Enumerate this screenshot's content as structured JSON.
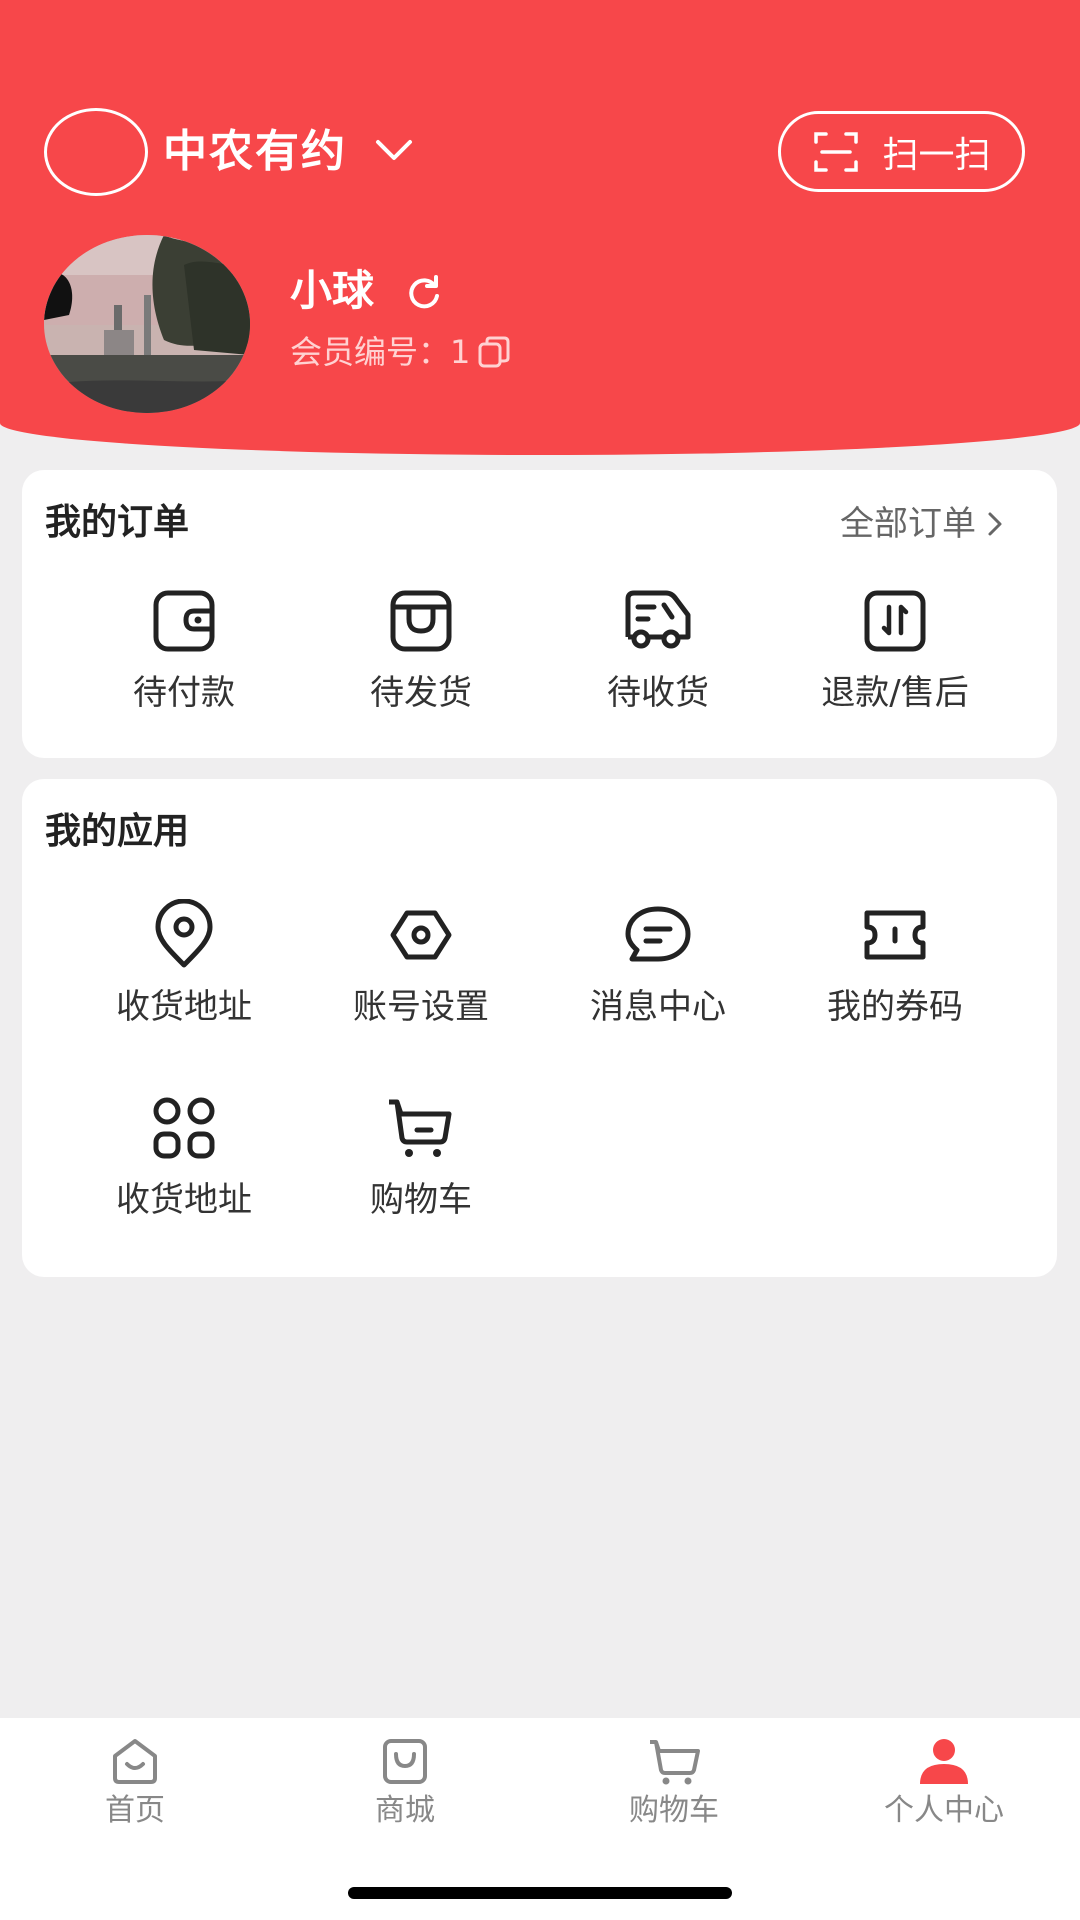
{
  "header": {
    "store_name": "中农有约",
    "scan_label": "扫一扫",
    "user_name": "小球",
    "member_label": "会员编号：",
    "member_number": "1"
  },
  "orders": {
    "title": "我的订单",
    "all_label": "全部订单",
    "items": [
      {
        "label": "待付款",
        "icon": "wallet-icon"
      },
      {
        "label": "待发货",
        "icon": "package-icon"
      },
      {
        "label": "待收货",
        "icon": "delivery-truck-icon"
      },
      {
        "label": "退款/售后",
        "icon": "refund-icon"
      }
    ]
  },
  "apps": {
    "title": "我的应用",
    "items": [
      {
        "label": "收货地址",
        "icon": "location-pin-icon"
      },
      {
        "label": "账号设置",
        "icon": "settings-hexagon-icon"
      },
      {
        "label": "消息中心",
        "icon": "message-bubble-icon"
      },
      {
        "label": "我的券码",
        "icon": "ticket-icon"
      },
      {
        "label": "收货地址",
        "icon": "grid-apps-icon"
      },
      {
        "label": "购物车",
        "icon": "cart-icon"
      }
    ]
  },
  "nav": {
    "items": [
      {
        "label": "首页",
        "icon": "home-icon"
      },
      {
        "label": "商城",
        "icon": "shop-bag-icon"
      },
      {
        "label": "购物车",
        "icon": "cart-icon"
      },
      {
        "label": "个人中心",
        "icon": "person-icon",
        "active": true
      }
    ]
  },
  "colors": {
    "accent": "#f7474a",
    "background": "#efeeef"
  }
}
